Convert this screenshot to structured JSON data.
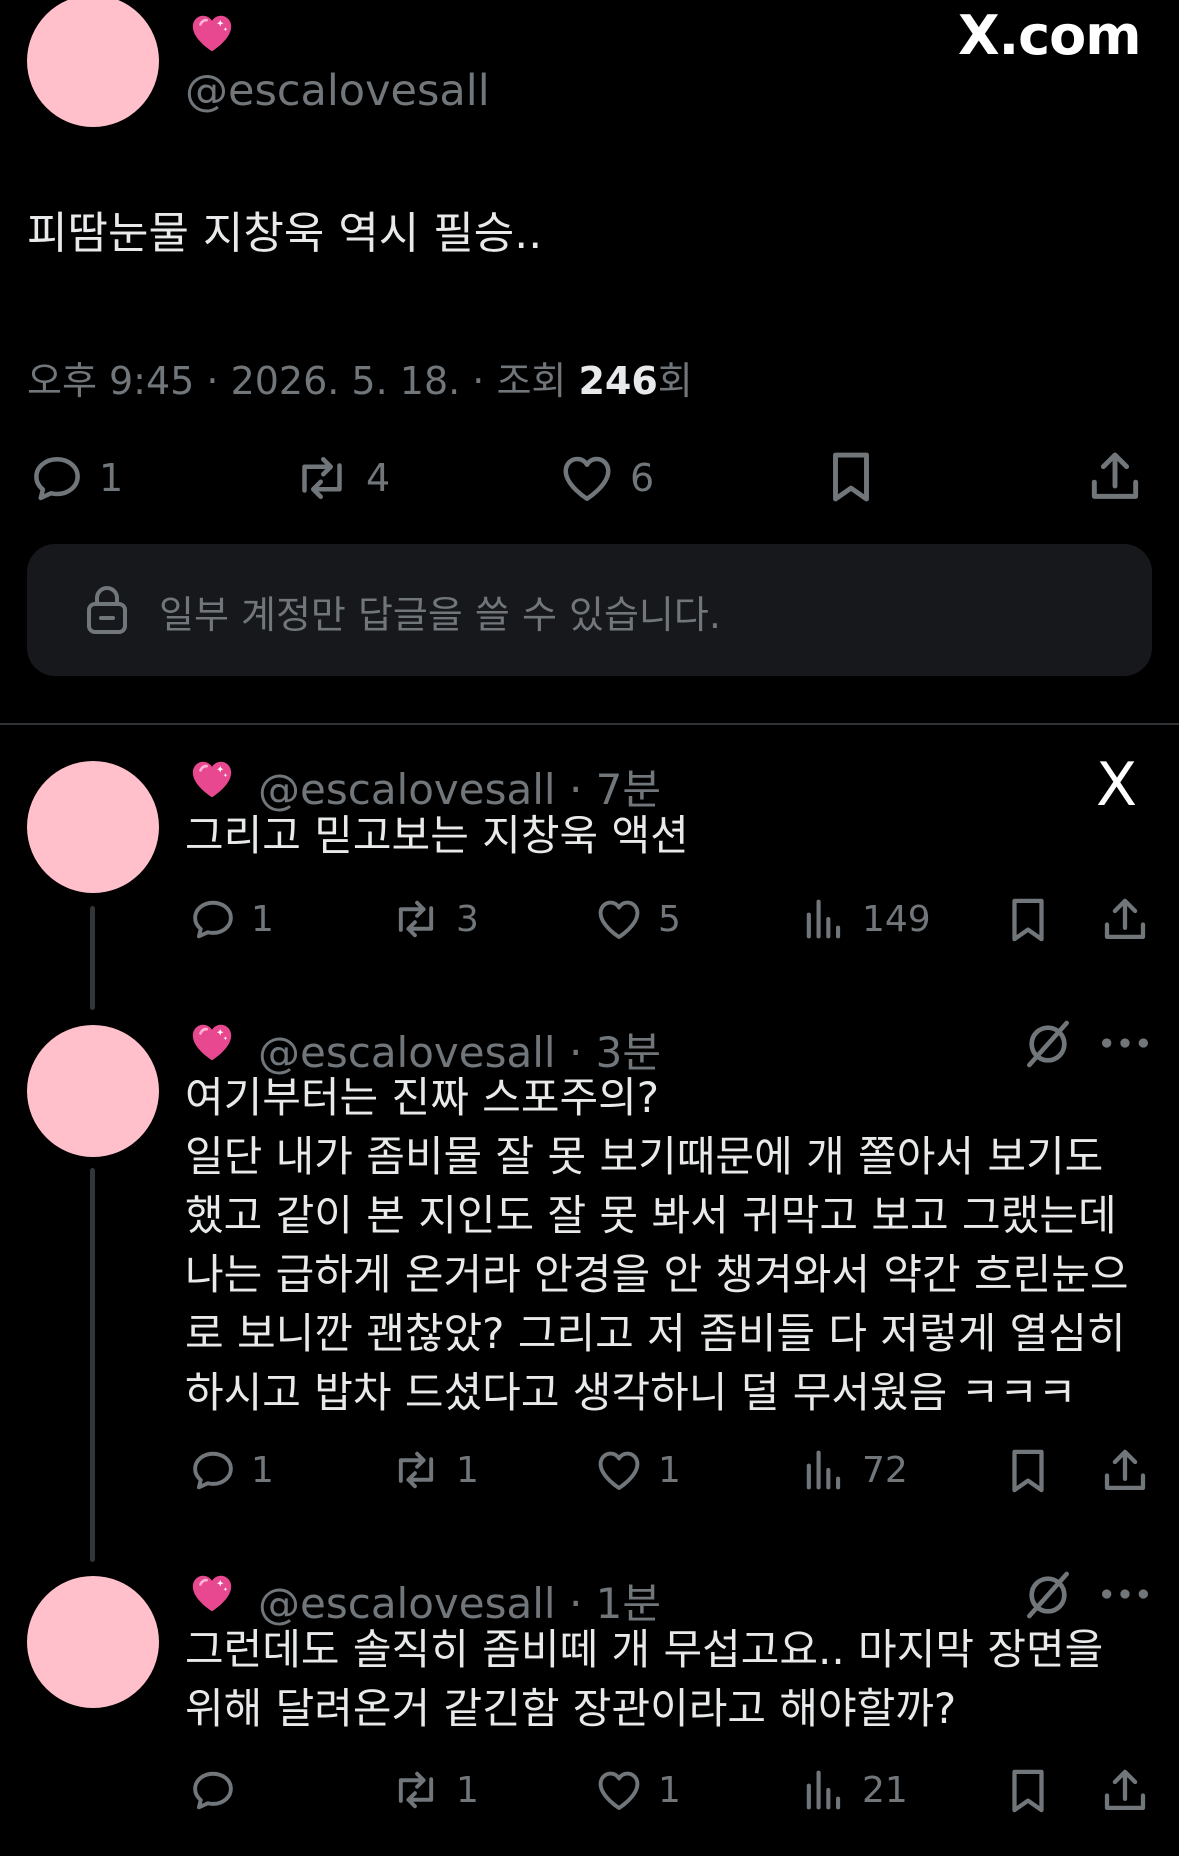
{
  "watermark": {
    "main": "X.com",
    "small": "X"
  },
  "main_tweet": {
    "handle": "@escalovesall",
    "text": "피땀눈물 지창욱 역시 필승..",
    "meta_prefix": "오후 9:45 · 2026. 5. 18. · 조회 ",
    "views": "246",
    "views_suffix": "회",
    "replies": "1",
    "retweets": "4",
    "likes": "6"
  },
  "reply_restriction": {
    "text": "일부 계정만 답글을 쓸 수 있습니다."
  },
  "thread": [
    {
      "handle": "@escalovesall",
      "time": "· 7분",
      "lines": [
        "그리고 믿고보는 지창욱 액션"
      ],
      "replies": "1",
      "retweets": "3",
      "likes": "5",
      "views": "149"
    },
    {
      "handle": "@escalovesall",
      "time": "· 3분",
      "lines": [
        "여기부터는 진짜 스포주의?",
        "일단 내가 좀비물 잘 못 보기때문에 개 쫄아서 보기도",
        "했고 같이 본 지인도 잘 못 봐서 귀막고 보고 그랬는데",
        "나는 급하게 온거라 안경을 안 챙겨와서 약간 흐린눈으",
        "로 보니깐 괜찮았? 그리고 저 좀비들 다 저렇게 열심히",
        "하시고 밥차 드셨다고 생각하니 덜 무서웠음 ㅋㅋㅋ"
      ],
      "replies": "1",
      "retweets": "1",
      "likes": "1",
      "views": "72"
    },
    {
      "handle": "@escalovesall",
      "time": "· 1분",
      "lines": [
        "그런데도 솔직히 좀비떼 개 무섭고요.. 마지막 장면을",
        "위해 달려온거 같긴함 장관이라고 해야할까?"
      ],
      "replies": "",
      "retweets": "1",
      "likes": "1",
      "views": "21"
    }
  ],
  "colors": {
    "avatar": "#ffc0cb",
    "muted": "#71767b",
    "text": "#e7e9ea",
    "background": "#000000"
  },
  "icons": [
    "pink-heart-emoji",
    "reply-icon",
    "retweet-icon",
    "like-icon",
    "views-icon",
    "bookmark-icon",
    "share-icon",
    "lock-icon",
    "translate-icon",
    "more-icon",
    "x-logo-icon"
  ]
}
